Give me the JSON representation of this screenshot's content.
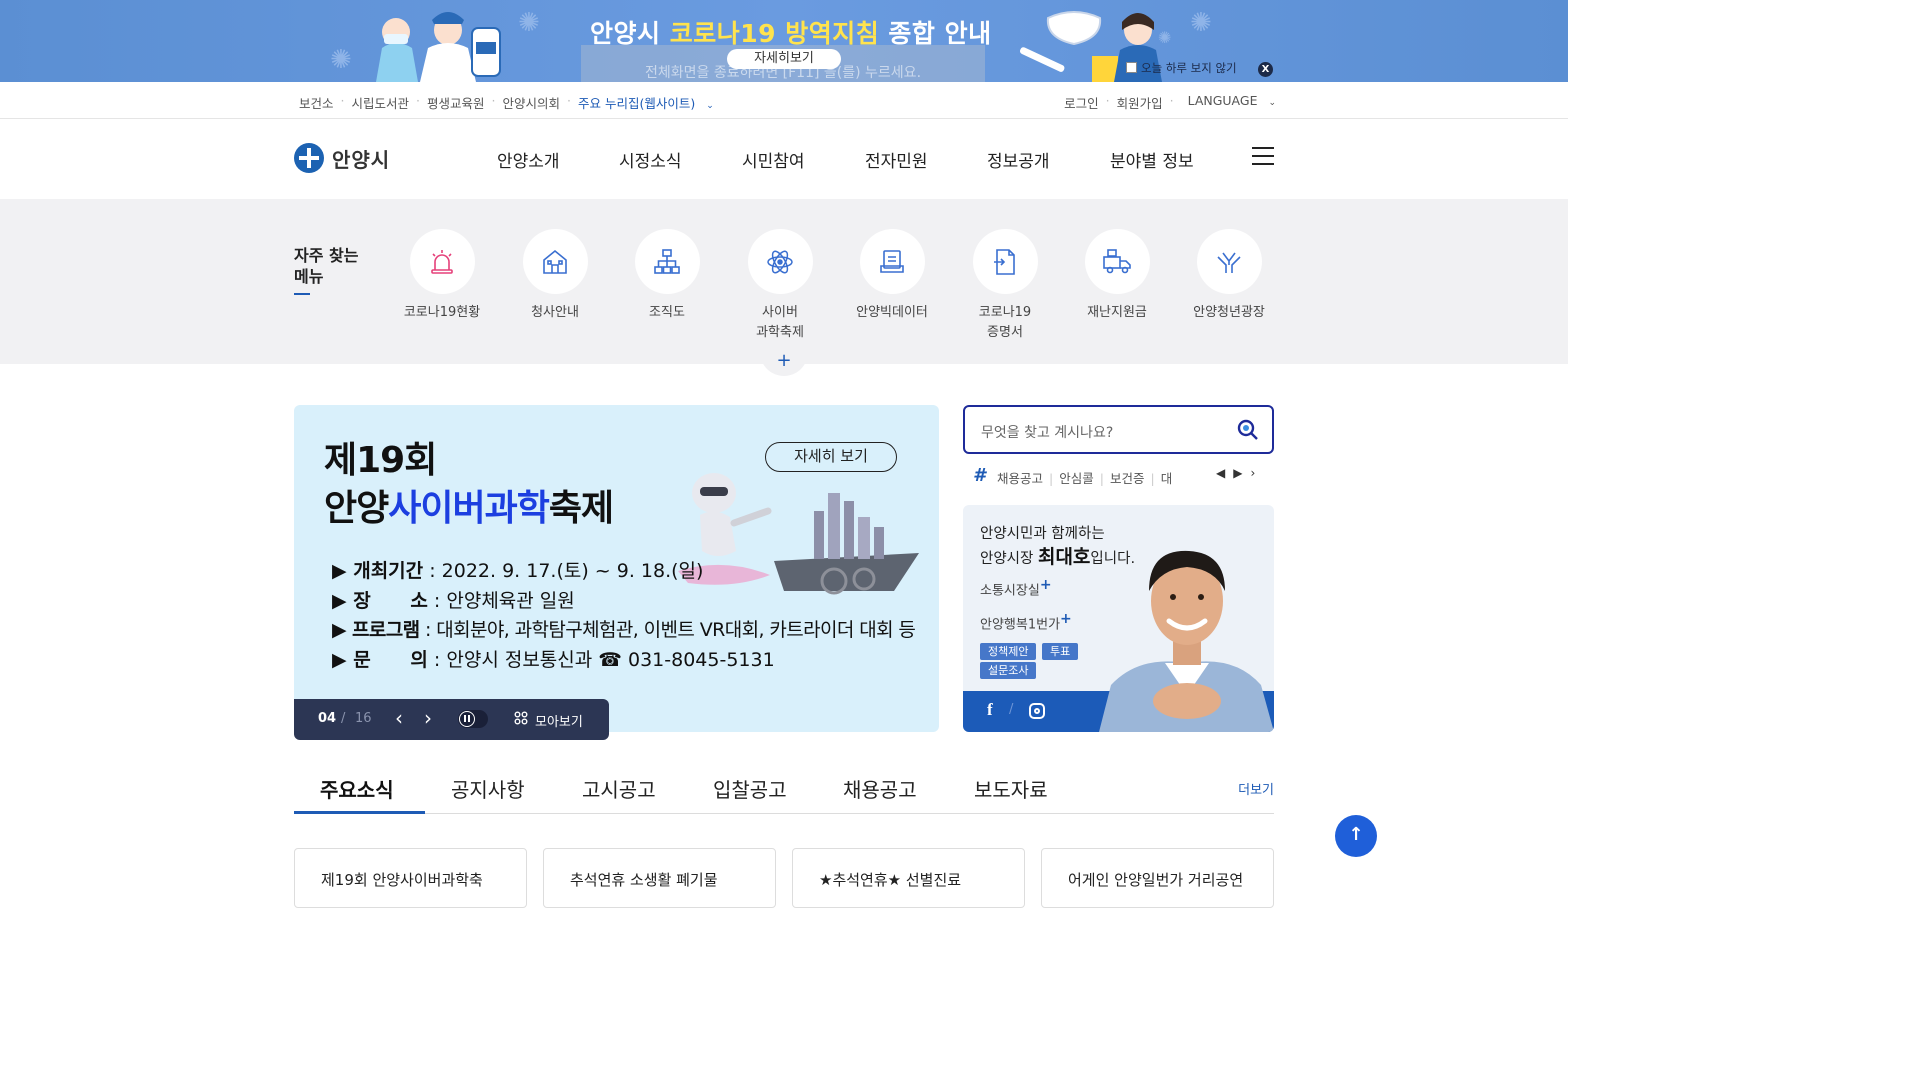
{
  "banner": {
    "title_prefix": "안양시 ",
    "title_highlight": "코로나19 방역지침",
    "title_suffix": " 종합 안내",
    "detail_label": "자세히보기",
    "fullscreen_hint": "전체화면을 종료하려면 [F11] 을(를) 누르세요.",
    "today_label": "오늘 하루 보지 않기",
    "close_label": "X"
  },
  "utility": {
    "links": [
      "보건소",
      "시립도서관",
      "평생교육원",
      "안양시의회"
    ],
    "sites_label": "주요 누리집(웹사이트)",
    "right": [
      "로그인",
      "회원가입",
      "LANGUAGE"
    ]
  },
  "header": {
    "logo_text": "안양시",
    "gnb": [
      "안양소개",
      "시정소식",
      "시민참여",
      "전자민원",
      "정보공개",
      "분야별 정보"
    ]
  },
  "quick": {
    "title_line1": "자주 찾는",
    "title_line2": "메뉴",
    "items": [
      {
        "label": "코로나19현황",
        "icon": "alarm-icon"
      },
      {
        "label": "청사안내",
        "icon": "building-icon"
      },
      {
        "label": "조직도",
        "icon": "org-chart-icon"
      },
      {
        "label": "사이버\n과학축제",
        "icon": "atom-icon"
      },
      {
        "label": "안양빅데이터",
        "icon": "data-icon"
      },
      {
        "label": "코로나19\n증명서",
        "icon": "document-icon"
      },
      {
        "label": "재난지원금",
        "icon": "truck-icon"
      },
      {
        "label": "안양청년광장",
        "icon": "hands-icon"
      }
    ],
    "more": "+"
  },
  "slide": {
    "line1": "제19회",
    "line2_a": "안양",
    "line2_b": "사이버과학",
    "line2_c": "축제",
    "more_label": "자세히 보기",
    "rows": [
      {
        "key": "▶ 개최기간",
        "val": " : 2022. 9. 17.(토) ~ 9. 18.(일)"
      },
      {
        "key": "▶ 장      소",
        "val": " : 안양체육관 일원"
      },
      {
        "key": "▶ 프로그램",
        "val": " : 대회분야, 과학탐구체험관, 이벤트 VR대회, 카트라이더 대회 등"
      },
      {
        "key": "▶ 문      의",
        "val": " : 안양시 정보통신과 ☎ 031-8045-5131"
      }
    ],
    "current": "04",
    "separator": "/",
    "total": "16",
    "all_label": "모아보기"
  },
  "search": {
    "placeholder": "무엇을 찾고 계시나요?",
    "tags": [
      "채용공고",
      "안심콜",
      "보건증",
      "대"
    ]
  },
  "mayor": {
    "line1": "안양시민과 함께하는",
    "line2_a": "안양시장 ",
    "line2_b": "최대호",
    "line2_c": "입니다.",
    "link1": "소통시장실",
    "link2": "안양행복1번가",
    "badges": [
      "정책제안",
      "투표",
      "설문조사"
    ],
    "facebook": "f"
  },
  "news": {
    "tabs": [
      "주요소식",
      "공지사항",
      "고시공고",
      "입찰공고",
      "채용공고",
      "보도자료"
    ],
    "more": "더보기",
    "cards": [
      "제19회 안양사이버과학축",
      "추석연휴 소생활 폐기물",
      "★추석연휴★ 선별진료",
      "어게인 안양일번가 거리공연"
    ]
  },
  "colors": {
    "brand": "#1e5bb5",
    "banner": "#5b8fd3",
    "slide_bg": "#d9f0fb",
    "control_bg": "#2c3654"
  }
}
